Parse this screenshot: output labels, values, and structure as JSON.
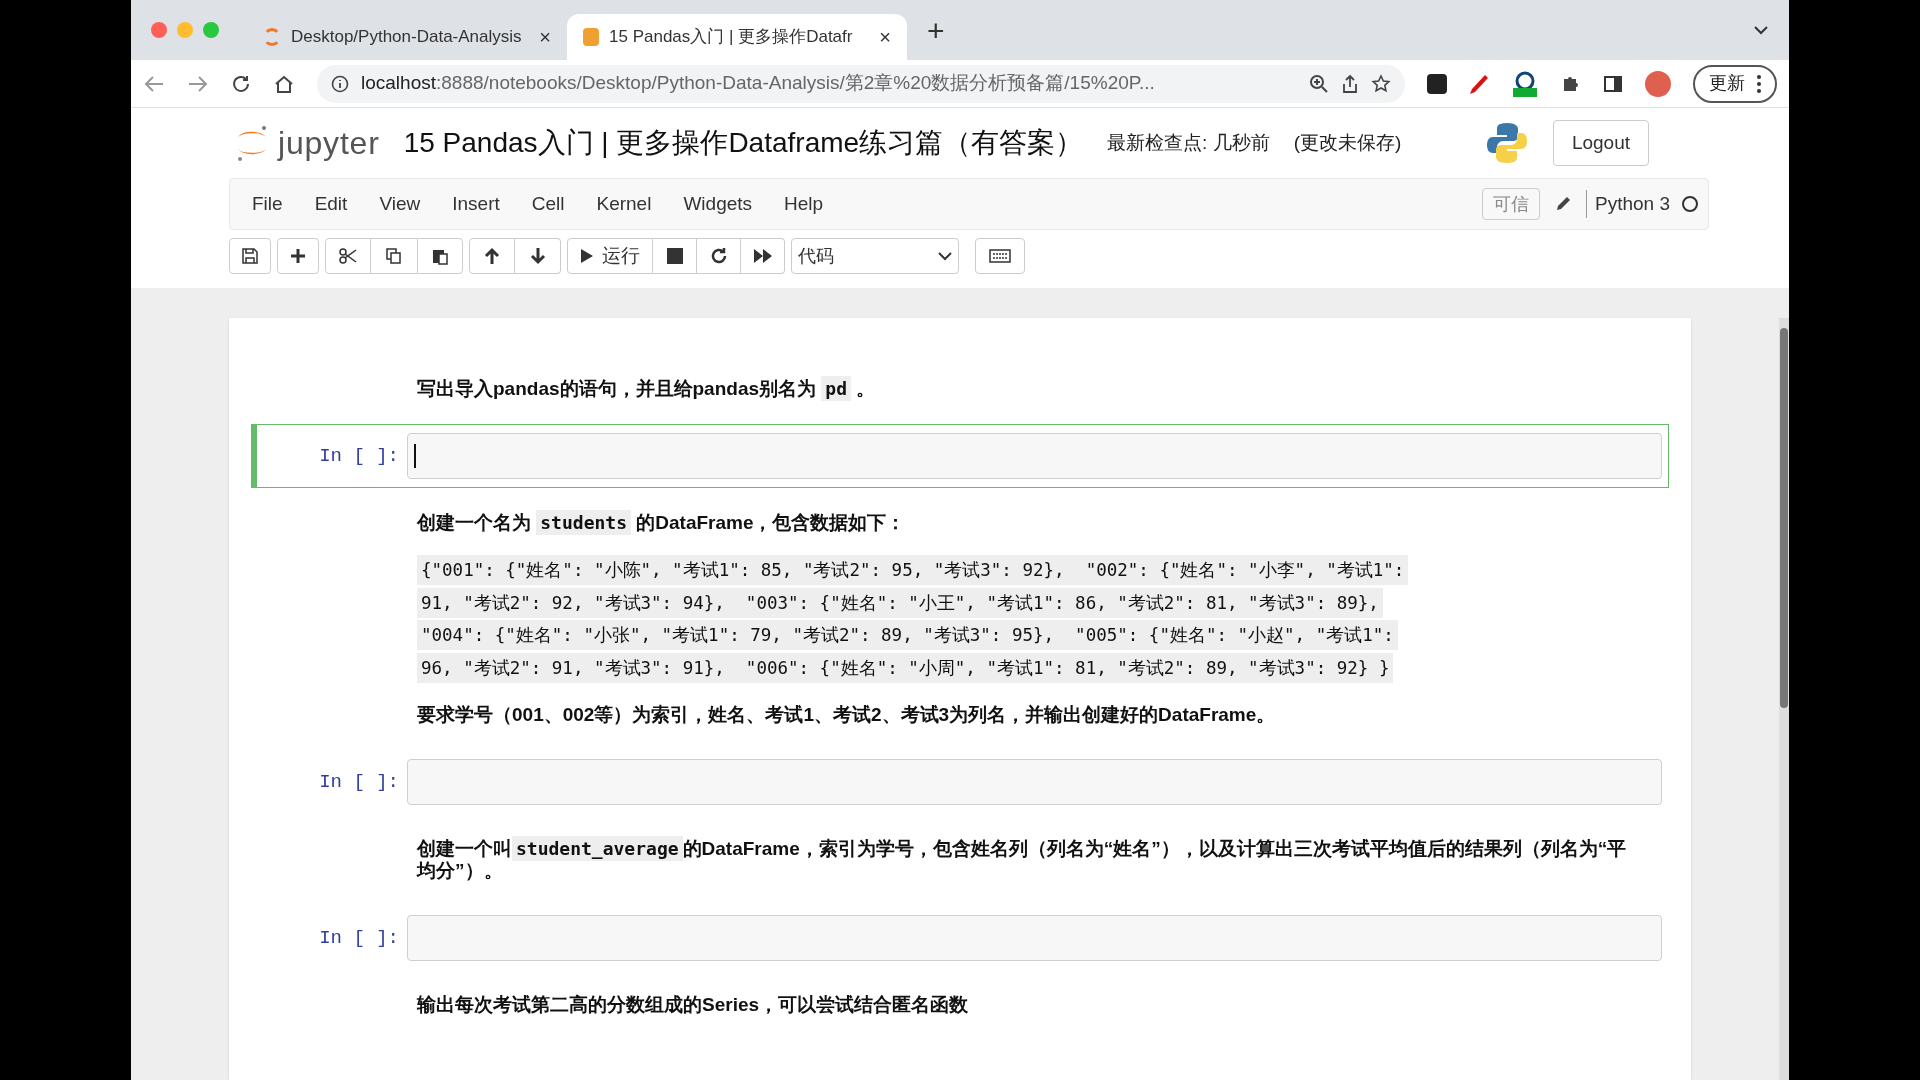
{
  "browser": {
    "tabs": [
      {
        "title": "Desktop/Python-Data-Analysis",
        "selected": false,
        "close": "×"
      },
      {
        "title": "15 Pandas入门 | 更多操作Datafr",
        "selected": true,
        "close": "×"
      }
    ],
    "new_tab": "+",
    "address": {
      "host": "localhost",
      "rest": ":8888/notebooks/Desktop/Python-Data-Analysis/第2章%20数据分析预备篇/15%20P..."
    },
    "update_button": "更新"
  },
  "header": {
    "logo_text": "jupyter",
    "notebook_title": "15 Pandas入门 | 更多操作Dataframe练习篇（有答案）",
    "checkpoint": "最新检查点: 几秒前",
    "save_status": "(更改未保存)",
    "logout": "Logout"
  },
  "menu": {
    "items": [
      "File",
      "Edit",
      "View",
      "Insert",
      "Cell",
      "Kernel",
      "Widgets",
      "Help"
    ],
    "trusted": "可信",
    "kernel": "Python 3"
  },
  "toolbar": {
    "run_label": "运行",
    "cell_type": "代码"
  },
  "cells": [
    {
      "kind": "markdown",
      "segments": [
        {
          "kind": "text",
          "text": "写出导入pandas的语句，并且给pandas别名为 "
        },
        {
          "kind": "code",
          "text": "pd"
        },
        {
          "kind": "text",
          "text": " 。"
        }
      ]
    },
    {
      "kind": "code",
      "prompt": "In [ ]:",
      "selected": true
    },
    {
      "kind": "markdown",
      "segments": [
        {
          "kind": "text",
          "text": "创建一个名为 "
        },
        {
          "kind": "code",
          "text": "students"
        },
        {
          "kind": "text",
          "text": " 的DataFrame，包含数据如下："
        }
      ]
    },
    {
      "kind": "block",
      "lines": [
        "{\"001\": {\"姓名\": \"小陈\", \"考试1\": 85, \"考试2\": 95, \"考试3\": 92},  \"002\": {\"姓名\": \"小李\", \"考试1\":",
        "91, \"考试2\": 92, \"考试3\": 94},  \"003\": {\"姓名\": \"小王\", \"考试1\": 86, \"考试2\": 81, \"考试3\": 89},",
        "\"004\": {\"姓名\": \"小张\", \"考试1\": 79, \"考试2\": 89, \"考试3\": 95},  \"005\": {\"姓名\": \"小赵\", \"考试1\":",
        "96, \"考试2\": 91, \"考试3\": 91},  \"006\": {\"姓名\": \"小周\", \"考试1\": 81, \"考试2\": 89, \"考试3\": 92} }"
      ]
    },
    {
      "kind": "markdown",
      "segments": [
        {
          "kind": "text",
          "text": "要求学号（001、002等）为索引，姓名、考试1、考试2、考试3为列名，并输出创建好的DataFrame。"
        }
      ]
    },
    {
      "kind": "code",
      "prompt": "In [ ]:",
      "selected": false
    },
    {
      "kind": "markdown",
      "segments": [
        {
          "kind": "text",
          "text": "创建一个叫"
        },
        {
          "kind": "code",
          "text": "student_average"
        },
        {
          "kind": "text",
          "text": "的DataFrame，索引为学号，包含姓名列（列名为“姓名”），以及计算出三次考试平均值后的结果列（列名为“平均分”）。"
        }
      ]
    },
    {
      "kind": "code",
      "prompt": "In [ ]:",
      "selected": false
    },
    {
      "kind": "markdown",
      "segments": [
        {
          "kind": "text",
          "text": "输出每次考试第二高的分数组成的Series，可以尝试结合匿名函数"
        }
      ]
    }
  ]
}
